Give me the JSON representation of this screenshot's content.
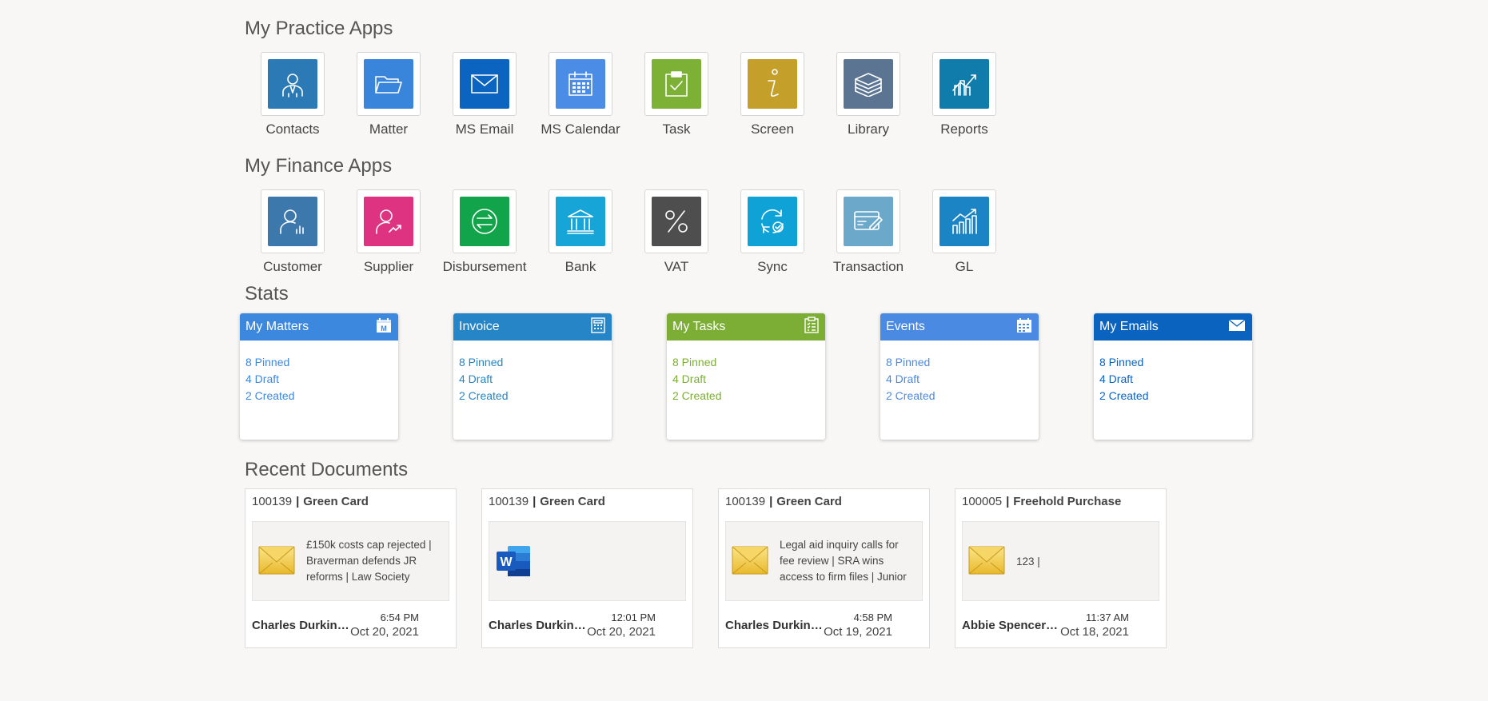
{
  "practice": {
    "title": "My Practice Apps",
    "apps": [
      {
        "label": "Contacts",
        "color": "#2c7ab5",
        "icon": "contacts-icon"
      },
      {
        "label": "Matter",
        "color": "#3a85dc",
        "icon": "folder-icon"
      },
      {
        "label": "MS Email",
        "color": "#0b64c0",
        "icon": "mail-icon"
      },
      {
        "label": "MS Calendar",
        "color": "#4b8de6",
        "icon": "calendar-icon"
      },
      {
        "label": "Task",
        "color": "#7cb136",
        "icon": "task-clipboard-icon"
      },
      {
        "label": "Screen",
        "color": "#c4a02b",
        "icon": "info-icon"
      },
      {
        "label": "Library",
        "color": "#5a7491",
        "icon": "books-icon"
      },
      {
        "label": "Reports",
        "color": "#0f7cab",
        "icon": "reports-chart-icon"
      }
    ]
  },
  "finance": {
    "title": "My Finance Apps",
    "apps": [
      {
        "label": "Customer",
        "color": "#3d78ad",
        "icon": "customer-icon"
      },
      {
        "label": "Supplier",
        "color": "#dd3381",
        "icon": "supplier-icon"
      },
      {
        "label": "Disbursement",
        "color": "#12a44a",
        "icon": "disbursement-icon"
      },
      {
        "label": "Bank",
        "color": "#17a4d7",
        "icon": "bank-icon"
      },
      {
        "label": "VAT",
        "color": "#4e4e4e",
        "icon": "percent-icon"
      },
      {
        "label": "Sync",
        "color": "#0fa2d6",
        "icon": "sync-icon"
      },
      {
        "label": "Transaction",
        "color": "#6ba8c9",
        "icon": "card-icon"
      },
      {
        "label": "GL",
        "color": "#1b84c5",
        "icon": "growth-chart-icon"
      }
    ]
  },
  "stats": {
    "title": "Stats",
    "cards": [
      {
        "title": "My Matters",
        "color": "#3d88df",
        "text_color": "#3d88df",
        "icon": "matter-calendar-icon",
        "lines": [
          "8 Pinned",
          "4 Draft",
          "2 Created"
        ]
      },
      {
        "title": "Invoice",
        "color": "#2685c6",
        "text_color": "#2685c6",
        "icon": "invoice-calculator-icon",
        "lines": [
          "8 Pinned",
          "4 Draft",
          "2 Created"
        ]
      },
      {
        "title": "My Tasks",
        "color": "#7cae36",
        "text_color": "#7cae36",
        "icon": "tasks-clipboard-icon",
        "lines": [
          "8 Pinned",
          "4 Draft",
          "2 Created"
        ]
      },
      {
        "title": "Events",
        "color": "#4b8ae3",
        "text_color": "#4b8ae3",
        "icon": "events-calendar-icon",
        "lines": [
          "8 Pinned",
          "4 Draft",
          "2 Created"
        ]
      },
      {
        "title": "My Emails",
        "color": "#0b63c0",
        "text_color": "#0b63c0",
        "icon": "envelope-icon",
        "lines": [
          "8 Pinned",
          "4 Draft",
          "2 Created"
        ]
      }
    ]
  },
  "recent": {
    "title": "Recent Documents",
    "docs": [
      {
        "number": "100139",
        "matter": "Green Card",
        "type": "email",
        "preview": "£150k costs cap rejected | Braverman defends JR reforms | Law Society",
        "author": "Charles Durkin(Ad…",
        "time": "6:54 PM",
        "date": "Oct 20, 2021"
      },
      {
        "number": "100139",
        "matter": "Green Card",
        "type": "word",
        "preview": "",
        "author": "Charles Durkin(Ad…",
        "time": "12:01 PM",
        "date": "Oct 20, 2021"
      },
      {
        "number": "100139",
        "matter": "Green Card",
        "type": "email",
        "preview": "Legal aid inquiry calls for fee review | SRA wins access to firm files | Junior",
        "author": "Charles Durkin(Ad…",
        "time": "4:58 PM",
        "date": "Oct 19, 2021"
      },
      {
        "number": "100005",
        "matter": "Freehold Purchase",
        "type": "email",
        "preview": "123 |",
        "author": "Abbie Spencer(Ad…",
        "time": "11:37 AM",
        "date": "Oct 18, 2021"
      }
    ]
  }
}
